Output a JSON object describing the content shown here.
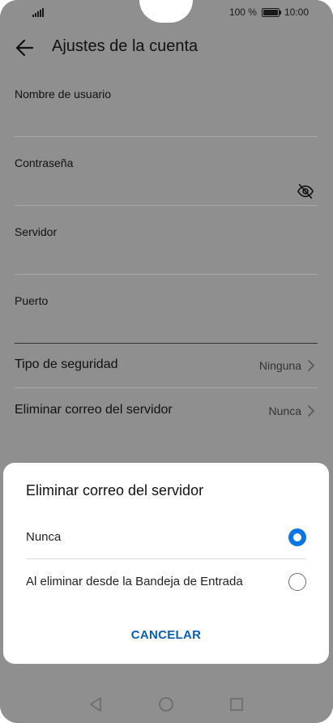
{
  "status_bar": {
    "battery_text": "100 %",
    "time": "10:00",
    "icons": [
      "signal-icon",
      "battery-icon"
    ]
  },
  "header": {
    "title": "Ajustes de la cuenta",
    "back_icon": "arrow-left-icon"
  },
  "fields": [
    {
      "label": "Nombre de usuario",
      "value": ""
    },
    {
      "label": "Contraseña",
      "value": "",
      "icon": "eye-off-icon"
    },
    {
      "label": "Servidor",
      "value": ""
    },
    {
      "label": "Puerto",
      "value": ""
    }
  ],
  "settings_rows": [
    {
      "label": "Tipo de seguridad",
      "value": "Ninguna",
      "icon": "chevron-right-icon"
    },
    {
      "label": "Eliminar correo del servidor",
      "value": "Nunca",
      "icon": "chevron-right-icon"
    }
  ],
  "dialog": {
    "title": "Eliminar correo del servidor",
    "options": [
      {
        "label": "Nunca",
        "selected": true
      },
      {
        "label": "Al eliminar desde la Bandeja de Entrada",
        "selected": false
      }
    ],
    "cancel_label": "CANCELAR"
  },
  "nav_bar": {
    "icons": [
      "back-triangle-icon",
      "home-circle-icon",
      "recents-square-icon"
    ]
  },
  "colors": {
    "accent": "#0a76e6",
    "cancel_text": "#0a5fb8",
    "scrim_background": "#8f8f8f",
    "dialog_background": "#ffffff"
  }
}
